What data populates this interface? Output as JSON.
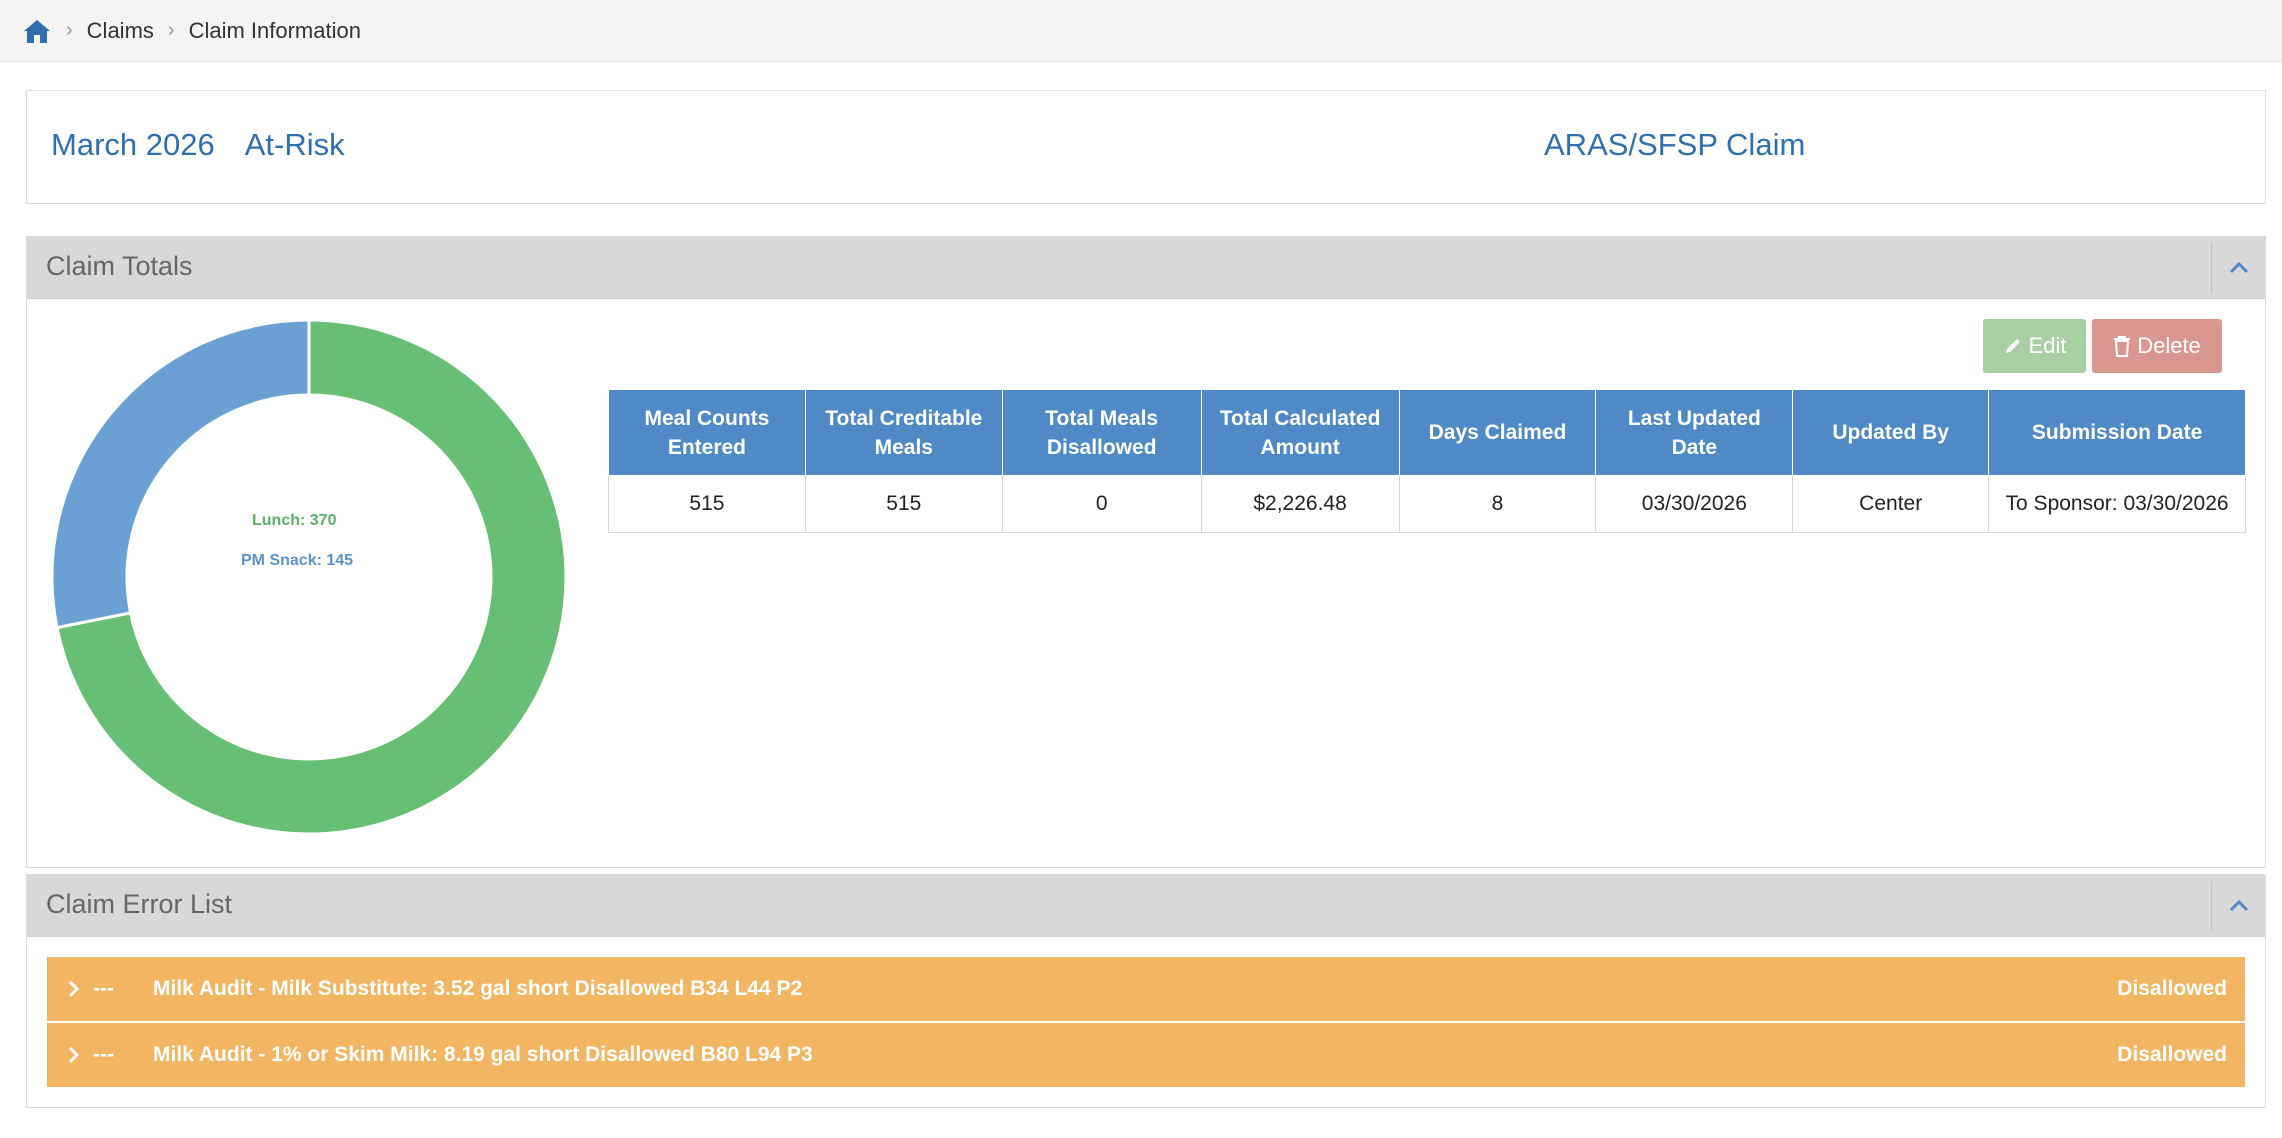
{
  "breadcrumb": {
    "items": [
      "Claims",
      "Claim Information"
    ]
  },
  "header": {
    "month": "March 2026",
    "program": "At-Risk",
    "claim_type": "ARAS/SFSP Claim",
    "title_color": "#2f6fb0"
  },
  "totals_panel": {
    "title": "Claim Totals",
    "edit_label": "Edit",
    "delete_label": "Delete",
    "table": {
      "headers": [
        "Meal Counts Entered",
        "Total Creditable Meals",
        "Total Meals Disallowed",
        "Total Calculated Amount",
        "Days Claimed",
        "Last Updated Date",
        "Updated By",
        "Submission Date"
      ],
      "row": [
        "515",
        "515",
        "0",
        "$2,226.48",
        "8",
        "03/30/2026",
        "Center",
        "To Sponsor: 03/30/2026"
      ]
    },
    "chart_data": {
      "type": "pie",
      "style": "donut",
      "labels": [
        "Lunch: 370",
        "PM Snack: 145"
      ],
      "series": [
        {
          "name": "Lunch",
          "value": 370,
          "color": "#67bf75"
        },
        {
          "name": "PM Snack",
          "value": 145,
          "color": "#6ba0d4"
        }
      ]
    }
  },
  "errors_panel": {
    "title": "Claim Error List",
    "items": [
      {
        "dash": "---",
        "message": "Milk Audit - Milk Substitute: 3.52 gal short Disallowed B34 L44 P2",
        "status": "Disallowed"
      },
      {
        "dash": "---",
        "message": "Milk Audit - 1% or Skim Milk: 8.19 gal short Disallowed B80 L94 P3",
        "status": "Disallowed"
      }
    ],
    "row_color": "#f2b663"
  }
}
